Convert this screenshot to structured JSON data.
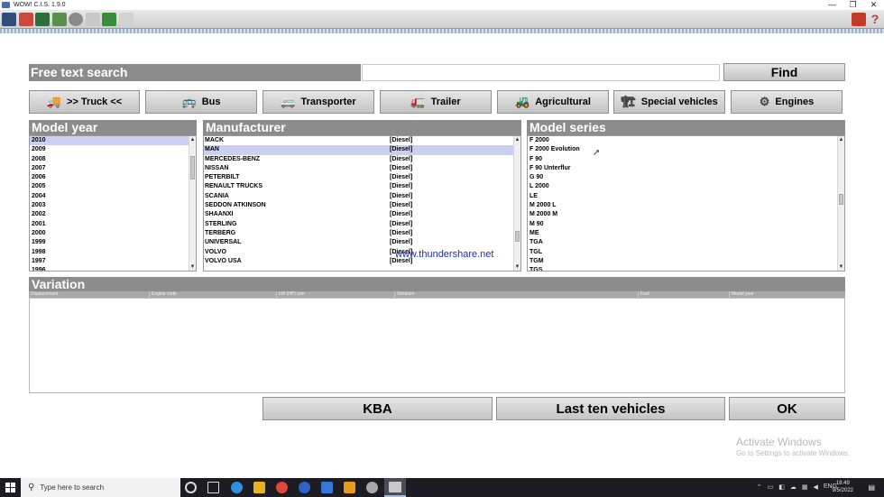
{
  "window": {
    "title": "WOW! C.I.S. 1.9.0",
    "controls": [
      "—",
      "❐",
      "✕"
    ]
  },
  "search": {
    "label": "Free text search",
    "value": "",
    "find_label": "Find"
  },
  "categories": [
    {
      "label": ">> Truck <<",
      "icon": "truck-icon",
      "glyph": "🚚"
    },
    {
      "label": "Bus",
      "icon": "bus-icon",
      "glyph": "🚌"
    },
    {
      "label": "Transporter",
      "icon": "van-icon",
      "glyph": "🚐"
    },
    {
      "label": "Trailer",
      "icon": "trailer-icon",
      "glyph": "🚛"
    },
    {
      "label": "Agricultural",
      "icon": "tractor-icon",
      "glyph": "🚜"
    },
    {
      "label": "Special vehicles",
      "icon": "crane-icon",
      "glyph": "🏗"
    },
    {
      "label": "Engines",
      "icon": "engine-icon",
      "glyph": "⚙"
    }
  ],
  "model_year": {
    "title": "Model year",
    "selected_index": 0,
    "items": [
      "2010",
      "2009",
      "2008",
      "2007",
      "2006",
      "2005",
      "2004",
      "2003",
      "2002",
      "2001",
      "2000",
      "1999",
      "1998",
      "1997",
      "1996"
    ]
  },
  "manufacturer": {
    "title": "Manufacturer",
    "selected_index": 1,
    "items": [
      {
        "name": "MACK",
        "fuel": "[Diesel]"
      },
      {
        "name": "MAN",
        "fuel": "[Diesel]"
      },
      {
        "name": "MERCEDES-BENZ",
        "fuel": "[Diesel]"
      },
      {
        "name": "NISSAN",
        "fuel": "[Diesel]"
      },
      {
        "name": "PETERBILT",
        "fuel": "[Diesel]"
      },
      {
        "name": "RENAULT TRUCKS",
        "fuel": "[Diesel]"
      },
      {
        "name": "SCANIA",
        "fuel": "[Diesel]"
      },
      {
        "name": "SEDDON ATKINSON",
        "fuel": "[Diesel]"
      },
      {
        "name": "SHAANXI",
        "fuel": "[Diesel]"
      },
      {
        "name": "STERLING",
        "fuel": "[Diesel]"
      },
      {
        "name": "TERBERG",
        "fuel": "[Diesel]"
      },
      {
        "name": "UNIVERSAL",
        "fuel": "[Diesel]"
      },
      {
        "name": "VOLVO",
        "fuel": "[Diesel]"
      },
      {
        "name": "VOLVO USA",
        "fuel": "[Diesel]"
      }
    ]
  },
  "model_series": {
    "title": "Model series",
    "items": [
      "F 2000",
      "F 2000 Evolution",
      "F 90",
      "F 90 Unterflur",
      "G 90",
      "L 2000",
      "LE",
      "M 2000 L",
      "M 2000 M",
      "M 90",
      "ME",
      "TGA",
      "TGL",
      "TGM",
      "TGS"
    ]
  },
  "watermark": "www.thundershare.net",
  "variation": {
    "title": "Variation",
    "columns": [
      "Displacement",
      "Engine code",
      "kW (HP) rpm",
      "Variation",
      "Fuel",
      "Model year"
    ]
  },
  "bottom_buttons": {
    "kba": "KBA",
    "last_ten": "Last ten vehicles",
    "ok": "OK"
  },
  "activate_windows": {
    "line1": "Activate Windows",
    "line2": "Go to Settings to activate Windows."
  },
  "taskbar": {
    "search_placeholder": "Type here to search",
    "lang": "ENG",
    "time": "18:49",
    "date": "9/5/2022"
  },
  "colors": {
    "header_gray": "#8c8c8c",
    "selection": "#cbd0f2",
    "watermark": "#1c2ea6"
  }
}
